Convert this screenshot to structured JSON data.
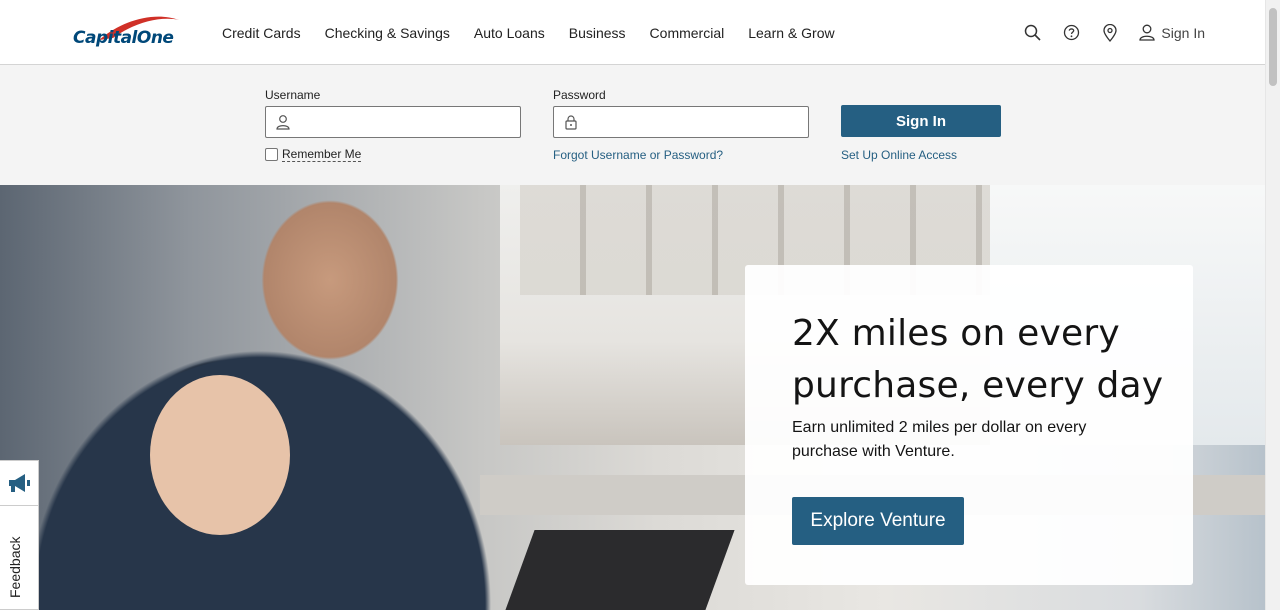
{
  "brand": {
    "logo_text": "CapitalOne",
    "accent_color": "#255f82",
    "logo_red": "#d03027"
  },
  "nav": {
    "items": [
      {
        "label": "Credit Cards"
      },
      {
        "label": "Checking & Savings"
      },
      {
        "label": "Auto Loans"
      },
      {
        "label": "Business"
      },
      {
        "label": "Commercial"
      },
      {
        "label": "Learn & Grow"
      }
    ]
  },
  "utility": {
    "search_icon": "search-icon",
    "help_icon": "help-icon",
    "location_icon": "location-pin-icon",
    "signin_label": "Sign In"
  },
  "login": {
    "username_label": "Username",
    "username_value": "",
    "password_label": "Password",
    "password_value": "",
    "remember_label": "Remember Me",
    "remember_checked": false,
    "forgot_link": "Forgot Username or Password?",
    "signin_button": "Sign In",
    "setup_link": "Set Up Online Access"
  },
  "hero": {
    "title": "2X miles on every purchase, every day",
    "text": "Earn unlimited 2 miles per dollar on every purchase with Venture.",
    "cta": "Explore Venture"
  },
  "feedback": {
    "label": "Feedback",
    "icon": "megaphone-icon"
  }
}
